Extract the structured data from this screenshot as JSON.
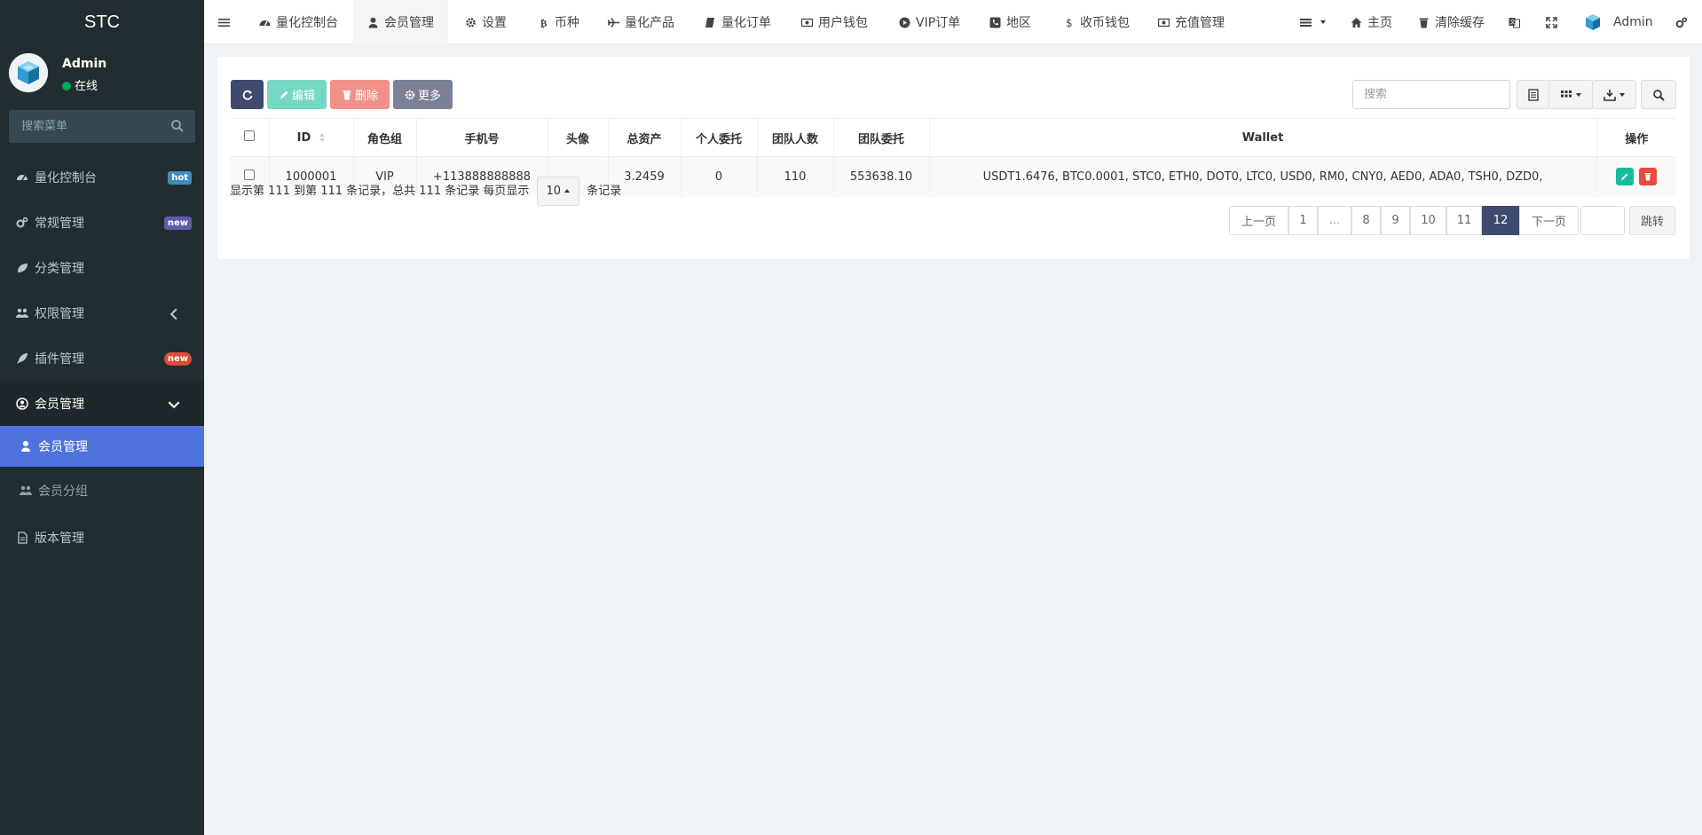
{
  "app": {
    "logo": "STC"
  },
  "user": {
    "name": "Admin",
    "status": "在线"
  },
  "sidebar": {
    "search_placeholder": "搜索菜单",
    "items": [
      {
        "label": "量化控制台",
        "badge": "hot",
        "badge_color": "#3c8dbc"
      },
      {
        "label": "常规管理",
        "badge": "new",
        "badge_color": "#605ca8"
      },
      {
        "label": "分类管理"
      },
      {
        "label": "权限管理"
      },
      {
        "label": "插件管理",
        "badge": "new",
        "badge_color": "#dd4b39"
      },
      {
        "label": "会员管理"
      }
    ],
    "sub_items": [
      {
        "label": "会员管理"
      },
      {
        "label": "会员分组"
      }
    ],
    "last_item": {
      "label": "版本管理"
    }
  },
  "header": {
    "tabs": [
      {
        "label": "量化控制台",
        "icon": "dashboard-icon"
      },
      {
        "label": "会员管理",
        "icon": "user-icon"
      },
      {
        "label": "设置",
        "icon": "gear-icon"
      },
      {
        "label": "币种",
        "icon": "bitcoin-icon"
      },
      {
        "label": "量化产品",
        "icon": "plane-icon"
      },
      {
        "label": "量化订单",
        "icon": "book-icon"
      },
      {
        "label": "用户钱包",
        "icon": "money-icon"
      },
      {
        "label": "VIP订单",
        "icon": "circle-icon"
      },
      {
        "label": "地区",
        "icon": "phone-square-icon"
      },
      {
        "label": "收币钱包",
        "icon": "dollar-icon"
      },
      {
        "label": "充值管理",
        "icon": "money-icon"
      }
    ],
    "right": {
      "home": "主页",
      "clear_cache": "清除缓存",
      "admin": "Admin"
    }
  },
  "toolbar": {
    "edit": "编辑",
    "delete": "删除",
    "more": "更多",
    "search_placeholder": "搜索",
    "colors": {
      "refresh": "#3e4b6e",
      "edit": "#76d7c4",
      "delete": "#f1928a",
      "more": "#7b8097"
    }
  },
  "table": {
    "columns": [
      "ID",
      "角色组",
      "手机号",
      "头像",
      "总资产",
      "个人委托",
      "团队人数",
      "团队委托",
      "Wallet",
      "操作"
    ],
    "rows": [
      {
        "id": "1000001",
        "role": "VIP",
        "phone": "+113888888888",
        "avatar": "",
        "assets": "3.2459",
        "personal": "0",
        "team_count": "110",
        "team_entrust": "553638.10",
        "wallet": "USDT1.6476, BTC0.0001, STC0, ETH0, DOT0, LTC0, USD0, RM0, CNY0, AED0, ADA0, TSH0, DZD0,"
      }
    ]
  },
  "pagination": {
    "info_prefix": "显示第 111 到第 111 条记录，总共 111 条记录 每页显示",
    "page_size": "10",
    "info_suffix": "条记录",
    "prev": "上一页",
    "pages": [
      "1",
      "...",
      "8",
      "9",
      "10",
      "11",
      "12"
    ],
    "current": "12",
    "next": "下一页",
    "jump": "跳转"
  }
}
